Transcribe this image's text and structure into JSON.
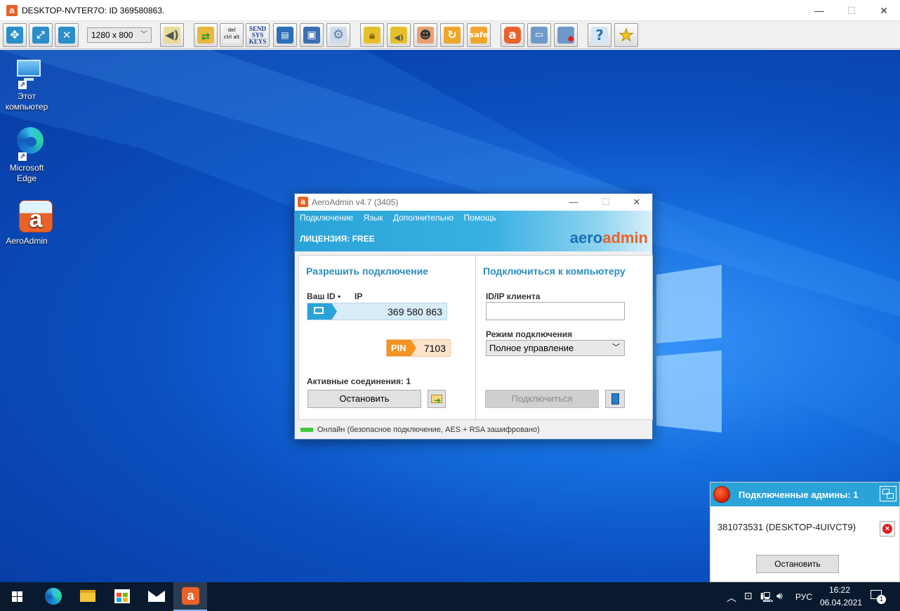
{
  "window": {
    "title": "DESKTOP-NVTER7O: ID 369580863.",
    "app_icon_letter": "a"
  },
  "toolbar": {
    "resolution": "1280 x 800",
    "buttons": [
      {
        "name": "fit-screen-icon",
        "color": "#2a8ec9"
      },
      {
        "name": "fullscreen-icon",
        "color": "#2a8ec9"
      },
      {
        "name": "settings-tools-icon",
        "color": "#2a8ec9"
      },
      {
        "name": "sound-icon",
        "color": "#d6c35a"
      },
      {
        "name": "file-transfer-icon",
        "color": "#e9b93d"
      },
      {
        "name": "ctrl-alt-del-icon",
        "color": "#e4e4e4"
      },
      {
        "name": "send-sys-keys-icon",
        "color": "#e4e4e4"
      },
      {
        "name": "remote-info-icon",
        "color": "#2a6fb8"
      },
      {
        "name": "device-manager-icon",
        "color": "#3d6fb3"
      },
      {
        "name": "options-gear-icon",
        "color": "#9fb9d4"
      },
      {
        "name": "lock-icon",
        "color": "#e6c02b"
      },
      {
        "name": "lock-audio-icon",
        "color": "#e6c02b"
      },
      {
        "name": "user-icon",
        "color": "#e27b3f"
      },
      {
        "name": "refresh-icon",
        "color": "#f0a62a"
      },
      {
        "name": "safe-icon",
        "color": "#f0a62a"
      },
      {
        "name": "aeroadmin-icon",
        "color": "#e8622a"
      },
      {
        "name": "screenshot-icon",
        "color": "#6d9ac8"
      },
      {
        "name": "record-icon",
        "color": "#6d9ac8"
      },
      {
        "name": "help-icon",
        "color": "#2a6fb8"
      },
      {
        "name": "favorite-star-icon",
        "color": "#f3c520"
      }
    ],
    "ctrl_alt_del_text": {
      "a": "del",
      "b": "ctrl",
      "c": "alt"
    },
    "send_keys_text": {
      "l1": "SEND",
      "l2": "SYS",
      "l3": "KEYS"
    },
    "safe_text": "safe"
  },
  "desktop": {
    "icons": [
      {
        "label_1": "Этот",
        "label_2": "компьютер"
      },
      {
        "label_1": "Microsoft",
        "label_2": "Edge"
      },
      {
        "label_1": "AeroAdmin",
        "label_2": ""
      }
    ]
  },
  "aeroadmin": {
    "title": "AeroAdmin v4.7 (3405)",
    "menu": [
      "Подключение",
      "Язык",
      "Дополнительно",
      "Помощь"
    ],
    "license": "ЛИЦЕНЗИЯ: FREE",
    "logo_part1": "aero",
    "logo_part2": "admin",
    "allow": {
      "heading": "Разрешить подключение",
      "id_label": "Ваш ID •",
      "ip_label": "IP",
      "id_value": "369 580 863",
      "pin_label": "PIN",
      "pin_value": "7103",
      "active_label": "Активные соединения: 1",
      "stop_label": "Остановить"
    },
    "connect": {
      "heading": "Подключиться к компьютеру",
      "client_label": "ID/IP клиента",
      "client_value": "",
      "mode_label": "Режим подключения",
      "mode_value": "Полное управление",
      "connect_label": "Подключиться"
    },
    "status": "Онлайн (безопасное подключение, AES + RSA зашифровано)"
  },
  "notification": {
    "title": "Подключенные админы: 1",
    "admin": "381073531 (DESKTOP-4UIVCT9)",
    "stop_label": "Остановить"
  },
  "taskbar": {
    "time": "16:22",
    "date": "06.04.2021",
    "lang": "РУС",
    "notif_count": "1"
  },
  "colors": {
    "accent": "#2aa3d8",
    "pin": "#f39422",
    "online": "#3ec83e"
  }
}
